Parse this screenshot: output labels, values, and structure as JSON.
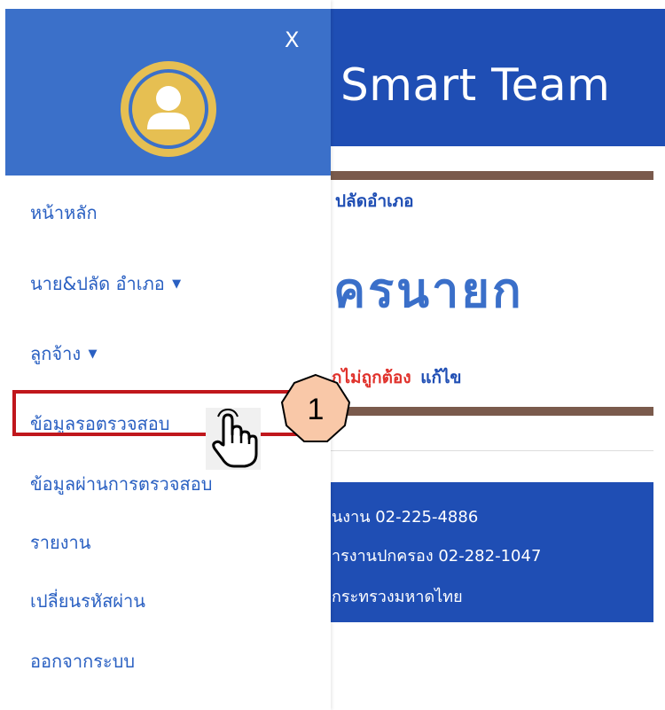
{
  "header": {
    "brand": "Smart Team"
  },
  "main": {
    "section_label": "ปลัดอำเภอ",
    "big_title": "ครนายก",
    "warning_text": "กไม่ถูกต้อง",
    "edit_link": "แก้ไข"
  },
  "footer": {
    "line1": "นงาน 02-225-4886",
    "line2": "ารงานปกครอง 02-282-1047",
    "line3": "กระทรวงมหาดไทย"
  },
  "sidebar": {
    "close_label": "X",
    "items": [
      {
        "label": "หน้าหลัก"
      },
      {
        "label": "นาย&ปลัด อำเภอ",
        "caret": "▼"
      },
      {
        "label": "ลูกจ้าง",
        "caret": "▼"
      },
      {
        "label": "ข้อมูลรอตรวจสอบ"
      },
      {
        "label": "ข้อมูลผ่านการตรวจสอบ"
      },
      {
        "label": "รายงาน"
      },
      {
        "label": "เปลี่ยนรหัสผ่าน"
      },
      {
        "label": "ออกจากระบบ"
      }
    ]
  },
  "annotation": {
    "step_number": "1"
  },
  "colors": {
    "header_blue": "#1f4eb4",
    "sidebar_blue": "#3b70c9",
    "avatar_gold": "#e6bf52",
    "highlight_red": "#c0171c",
    "badge_fill": "#f9c8a8",
    "divider_brown": "#7a5a4c"
  },
  "icons": {
    "avatar": "user-avatar-icon",
    "caret": "caret-down-icon",
    "pointer": "pointer-hand-icon"
  }
}
